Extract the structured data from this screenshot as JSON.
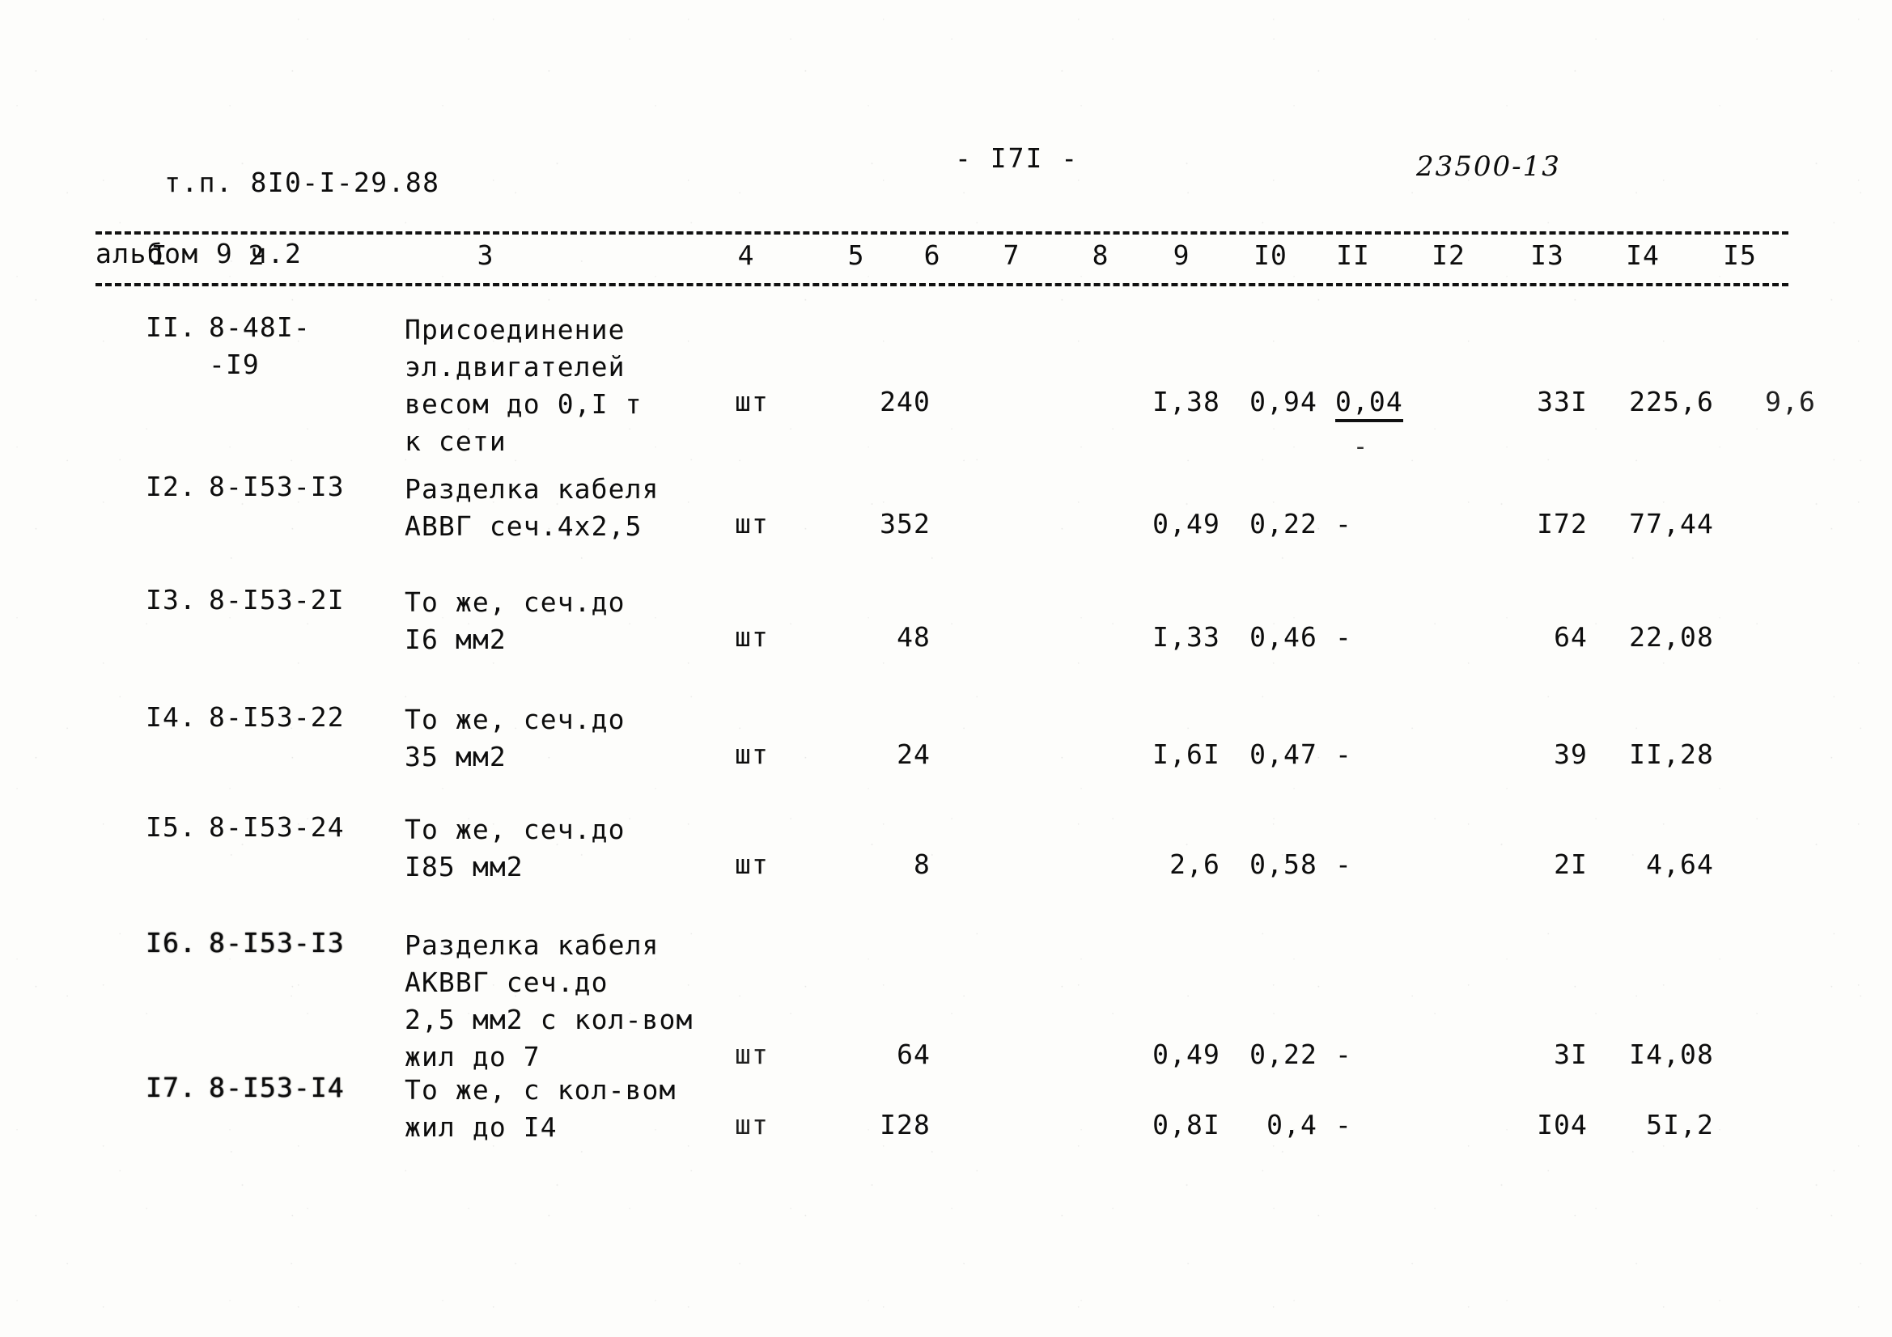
{
  "header": {
    "project_label": "т.п.",
    "project_code": "8I0-I-29.88",
    "album_line": "альбом 9 ч.2",
    "page_number": "- I7I -",
    "doc_code": "23500-13"
  },
  "table": {
    "column_headers": [
      "I",
      "2",
      "3",
      "4",
      "5",
      "6",
      "7",
      "8",
      "9",
      "I0",
      "II",
      "I2",
      "I3",
      "I4",
      "I5"
    ],
    "rows": [
      {
        "no": "II.",
        "code": "8-48I-\n-I9",
        "description": "Присоединение\nэл.двигателей\nвесом до 0,I т\nк сети",
        "unit": "шт",
        "qty": "240",
        "c9": "I,38",
        "c10": "0,94",
        "c11": "0,04",
        "c11_underlined": true,
        "c13": "33I",
        "c14": "225,6",
        "c15": "9,6"
      },
      {
        "no": "I2.",
        "code": "8-I53-I3",
        "description": "Разделка кабеля\nАВВГ сеч.4х2,5",
        "unit": "шт",
        "qty": "352",
        "c9": "0,49",
        "c10": "0,22",
        "c11": "-",
        "c11_underlined": false,
        "c13": "I72",
        "c14": "77,44",
        "c15": ""
      },
      {
        "no": "I3.",
        "code": "8-I53-2I",
        "description": "То же, сеч.до\nI6 мм2",
        "unit": "шт",
        "qty": "48",
        "c9": "I,33",
        "c10": "0,46",
        "c11": "-",
        "c11_underlined": false,
        "c13": "64",
        "c14": "22,08",
        "c15": ""
      },
      {
        "no": "I4.",
        "code": "8-I53-22",
        "description": "То же, сеч.до\n35 мм2",
        "unit": "шт",
        "qty": "24",
        "c9": "I,6I",
        "c10": "0,47",
        "c11": "-",
        "c11_underlined": false,
        "c13": "39",
        "c14": "II,28",
        "c15": ""
      },
      {
        "no": "I5.",
        "code": "8-I53-24",
        "description": "То же, сеч.до\nI85 мм2",
        "unit": "шт",
        "qty": "8",
        "c9": "2,6",
        "c10": "0,58",
        "c11": "-",
        "c11_underlined": false,
        "c13": "2I",
        "c14": "4,64",
        "c15": ""
      },
      {
        "no": "I6.",
        "code": "8-I53-I3",
        "description": "Разделка кабеля\nАКВВГ сеч.до\n2,5 мм2 с кол-вом\nжил до 7",
        "unit": "шт",
        "qty": "64",
        "c9": "0,49",
        "c10": "0,22",
        "c11": "-",
        "c11_underlined": false,
        "c13": "3I",
        "c14": "I4,08",
        "c15": ""
      },
      {
        "no": "I7.",
        "code": "8-I53-I4",
        "description": "То же, с кол-вом\nжил до I4",
        "unit": "шт",
        "qty": "I28",
        "c9": "0,8I",
        "c10": "0,4",
        "c11": "-",
        "c11_underlined": false,
        "c13": "I04",
        "c14": "5I,2",
        "c15": ""
      }
    ]
  }
}
